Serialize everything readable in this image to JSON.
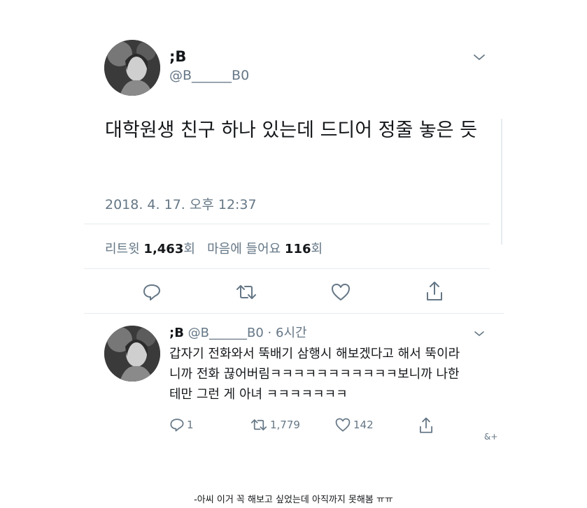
{
  "tweet": {
    "name": ";B",
    "handle": "@B______B0",
    "text": "대학원생 친구 하나 있는데 드디어 정줄 놓은 듯",
    "datetime": "2018. 4. 17. 오후 12:37",
    "retweets_label": "리트윗",
    "retweets_count": "1,463",
    "retweets_suffix": "회",
    "likes_label": "마음에 들어요",
    "likes_count": "116",
    "likes_suffix": "회"
  },
  "reply": {
    "name": ";B",
    "handle": "@B______B0",
    "time": "· 6시간",
    "text": "갑자기 전화와서 뚝배기 삼행시 해보겠다고 해서 뚝이라니까 전화 끊어버림ㅋㅋㅋㅋㅋㅋㅋㅋㅋㅋㅋ보니까 나한테만 그런 게 아녀 ㅋㅋㅋㅋㅋㅋㅋ",
    "reply_count": "1",
    "retweet_count": "1,779",
    "like_count": "142"
  },
  "watermark": "&+",
  "caption": "-아씨 이거 꼭 해보고 싶었는데 아직까지 못해봄 ㅠㅠ",
  "icons": [
    "chevron-down-icon",
    "reply-icon",
    "retweet-icon",
    "like-icon",
    "share-icon"
  ],
  "colors": {
    "text": "#14171a",
    "secondary": "#657786",
    "divider": "#e6ecf0"
  }
}
